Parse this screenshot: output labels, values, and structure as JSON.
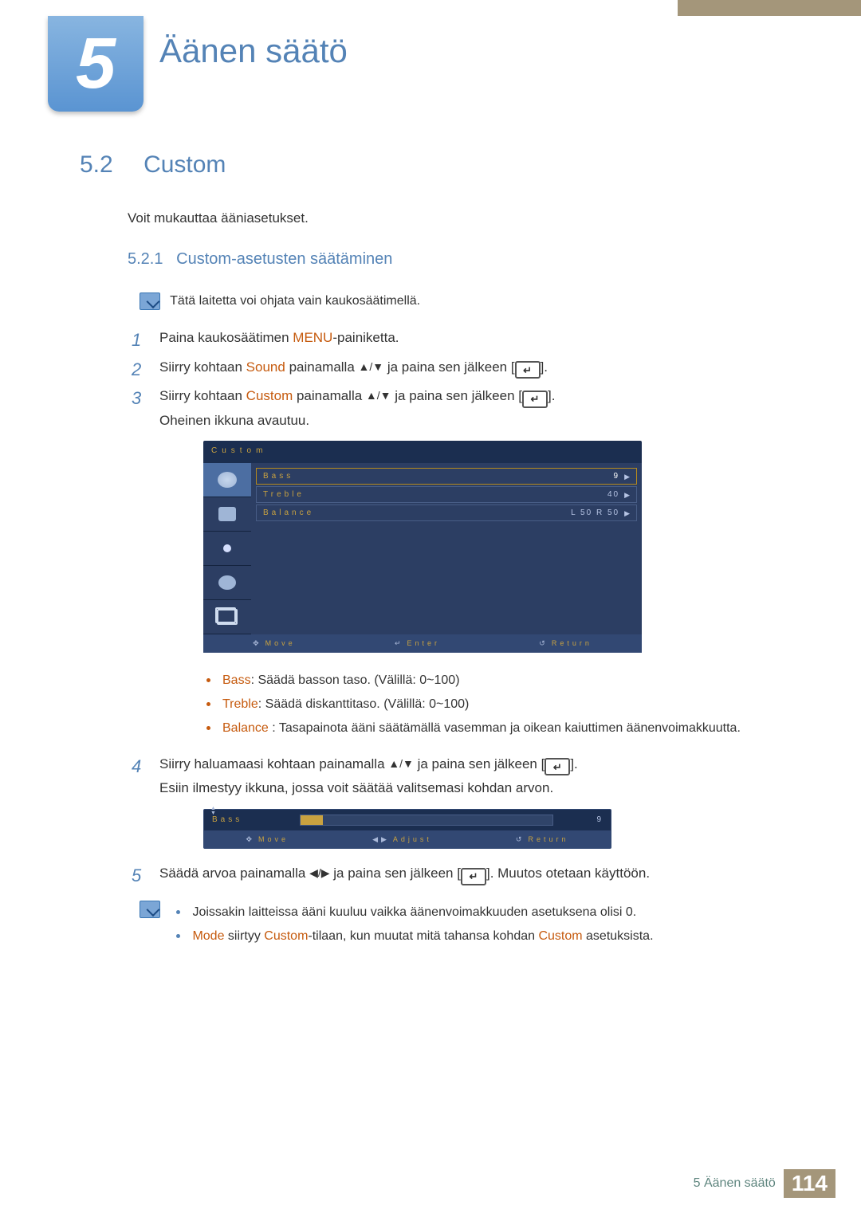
{
  "chapter": {
    "number": "5",
    "title": "Äänen säätö"
  },
  "section": {
    "number": "5.2",
    "title": "Custom"
  },
  "intro": "Voit mukauttaa ääniasetukset.",
  "subsection": {
    "number": "5.2.1",
    "title": "Custom-asetusten säätäminen"
  },
  "note1": "Tätä laitetta voi ohjata vain kaukosäätimellä.",
  "kw": {
    "menu": "MENU",
    "sound": "Sound",
    "custom": "Custom",
    "bass": "Bass",
    "treble": "Treble",
    "balance": "Balance",
    "mode": "Mode"
  },
  "steps": {
    "s1a": "Paina kaukosäätimen ",
    "s1b": "-painiketta.",
    "s2a": "Siirry kohtaan ",
    "s2b": " painamalla ",
    "s2c": " ja paina sen jälkeen [",
    "s2d": "].",
    "s3a": "Siirry kohtaan ",
    "s3mid": " painamalla ",
    "s3c": " ja paina sen jälkeen [",
    "s3d": "].",
    "s3e": "Oheinen ikkuna avautuu.",
    "s4a": "Siirry haluamaasi kohtaan painamalla ",
    "s4c": " ja paina sen jälkeen [",
    "s4d": "].",
    "s4e": "Esiin ilmestyy ikkuna, jossa voit säätää valitsemasi kohdan arvon.",
    "s5a": "Säädä arvoa painamalla ",
    "s5c": " ja paina sen jälkeen [",
    "s5d": "]. Muutos otetaan käyttöön."
  },
  "bullets1": {
    "bass": ": Säädä basson taso. (Välillä: 0~100)",
    "treble": ": Säädä diskanttitaso. (Välillä: 0~100)",
    "balance": " : Tasapainota ääni säätämällä vasemman ja oikean kaiuttimen äänenvoimakkuutta."
  },
  "bullets2": {
    "b1": "Joissakin laitteissa ääni kuuluu vaikka äänenvoimakkuuden asetuksena olisi 0.",
    "b2a": " siirtyy ",
    "b2b": "-tilaan, kun muutat mitä tahansa kohdan ",
    "b2c": " asetuksista."
  },
  "osd1": {
    "title": "Custom",
    "rows": [
      {
        "label": "Bass",
        "value": "9"
      },
      {
        "label": "Treble",
        "value": "40"
      },
      {
        "label": "Balance",
        "value": "L 50  R 50"
      }
    ],
    "foot": {
      "move": "Move",
      "enter": "Enter",
      "return": "Return"
    }
  },
  "osd2": {
    "label": "Bass",
    "value": "9",
    "foot": {
      "move": "Move",
      "adjust": "Adjust",
      "return": "Return"
    }
  },
  "footer": {
    "text": "5 Äänen säätö",
    "page": "114"
  },
  "glyph": {
    "updown": "▲/▼",
    "leftright": "◀/▶",
    "enter": "↵"
  }
}
